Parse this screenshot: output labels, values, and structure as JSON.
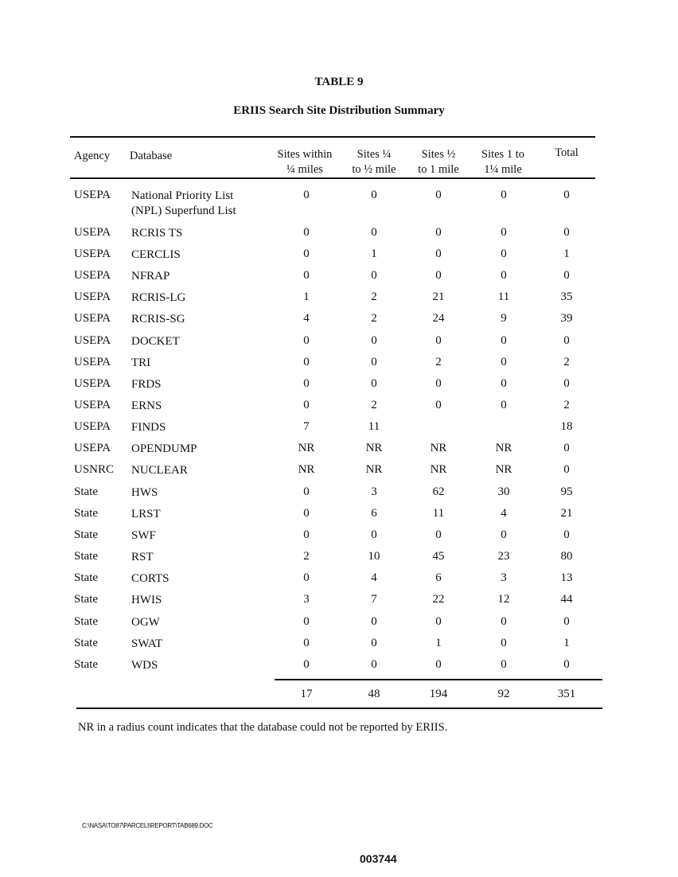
{
  "document": {
    "table_label": "TABLE 9",
    "title": "ERIIS Search Site Distribution Summary",
    "footnote": "NR in a radius count indicates that the database could not be reported by ERIIS.",
    "file_path": "C:\\NASA\\TO87\\PARCELI\\REPORT\\TAB689.DOC",
    "page_number": "003744"
  },
  "table": {
    "headers": {
      "agency": "Agency",
      "database": "Database",
      "c1_line1": "Sites within",
      "c1_line2": "¼ miles",
      "c2_line1": "Sites ¼",
      "c2_line2": "to ½ mile",
      "c3_line1": "Sites ½",
      "c3_line2": "to 1 mile",
      "c4_line1": "Sites 1 to",
      "c4_line2": "1¼ mile",
      "total": "Total"
    },
    "rows": [
      {
        "agency": "USEPA",
        "database": "National Priority List (NPL) Superfund List",
        "v": [
          "0",
          "0",
          "0",
          "0",
          "0"
        ]
      },
      {
        "agency": "USEPA",
        "database": "RCRIS TS",
        "v": [
          "0",
          "0",
          "0",
          "0",
          "0"
        ]
      },
      {
        "agency": "USEPA",
        "database": "CERCLIS",
        "v": [
          "0",
          "1",
          "0",
          "0",
          "1"
        ]
      },
      {
        "agency": "USEPA",
        "database": "NFRAP",
        "v": [
          "0",
          "0",
          "0",
          "0",
          "0"
        ]
      },
      {
        "agency": "USEPA",
        "database": "RCRIS-LG",
        "v": [
          "1",
          "2",
          "21",
          "11",
          "35"
        ]
      },
      {
        "agency": "USEPA",
        "database": "RCRIS-SG",
        "v": [
          "4",
          "2",
          "24",
          "9",
          "39"
        ]
      },
      {
        "agency": "USEPA",
        "database": "DOCKET",
        "v": [
          "0",
          "0",
          "0",
          "0",
          "0"
        ]
      },
      {
        "agency": "USEPA",
        "database": "TRI",
        "v": [
          "0",
          "0",
          "2",
          "0",
          "2"
        ]
      },
      {
        "agency": "USEPA",
        "database": "FRDS",
        "v": [
          "0",
          "0",
          "0",
          "0",
          "0"
        ]
      },
      {
        "agency": "USEPA",
        "database": "ERNS",
        "v": [
          "0",
          "2",
          "0",
          "0",
          "2"
        ]
      },
      {
        "agency": "USEPA",
        "database": "FINDS",
        "v": [
          "7",
          "11",
          "",
          "",
          "18"
        ]
      },
      {
        "agency": "USEPA",
        "database": "OPENDUMP",
        "v": [
          "NR",
          "NR",
          "NR",
          "NR",
          "0"
        ]
      },
      {
        "agency": "USNRC",
        "database": "NUCLEAR",
        "v": [
          "NR",
          "NR",
          "NR",
          "NR",
          "0"
        ]
      },
      {
        "agency": "State",
        "database": "HWS",
        "v": [
          "0",
          "3",
          "62",
          "30",
          "95"
        ]
      },
      {
        "agency": "State",
        "database": "LRST",
        "v": [
          "0",
          "6",
          "11",
          "4",
          "21"
        ]
      },
      {
        "agency": "State",
        "database": "SWF",
        "v": [
          "0",
          "0",
          "0",
          "0",
          "0"
        ]
      },
      {
        "agency": "State",
        "database": "RST",
        "v": [
          "2",
          "10",
          "45",
          "23",
          "80"
        ]
      },
      {
        "agency": "State",
        "database": "CORTS",
        "v": [
          "0",
          "4",
          "6",
          "3",
          "13"
        ]
      },
      {
        "agency": "State",
        "database": "HWIS",
        "v": [
          "3",
          "7",
          "22",
          "12",
          "44"
        ]
      },
      {
        "agency": "State",
        "database": "OGW",
        "v": [
          "0",
          "0",
          "0",
          "0",
          "0"
        ]
      },
      {
        "agency": "State",
        "database": "SWAT",
        "v": [
          "0",
          "0",
          "1",
          "0",
          "1"
        ]
      },
      {
        "agency": "State",
        "database": "WDS",
        "v": [
          "0",
          "0",
          "0",
          "0",
          "0"
        ]
      }
    ],
    "totals": [
      "17",
      "48",
      "194",
      "92",
      "351"
    ]
  }
}
